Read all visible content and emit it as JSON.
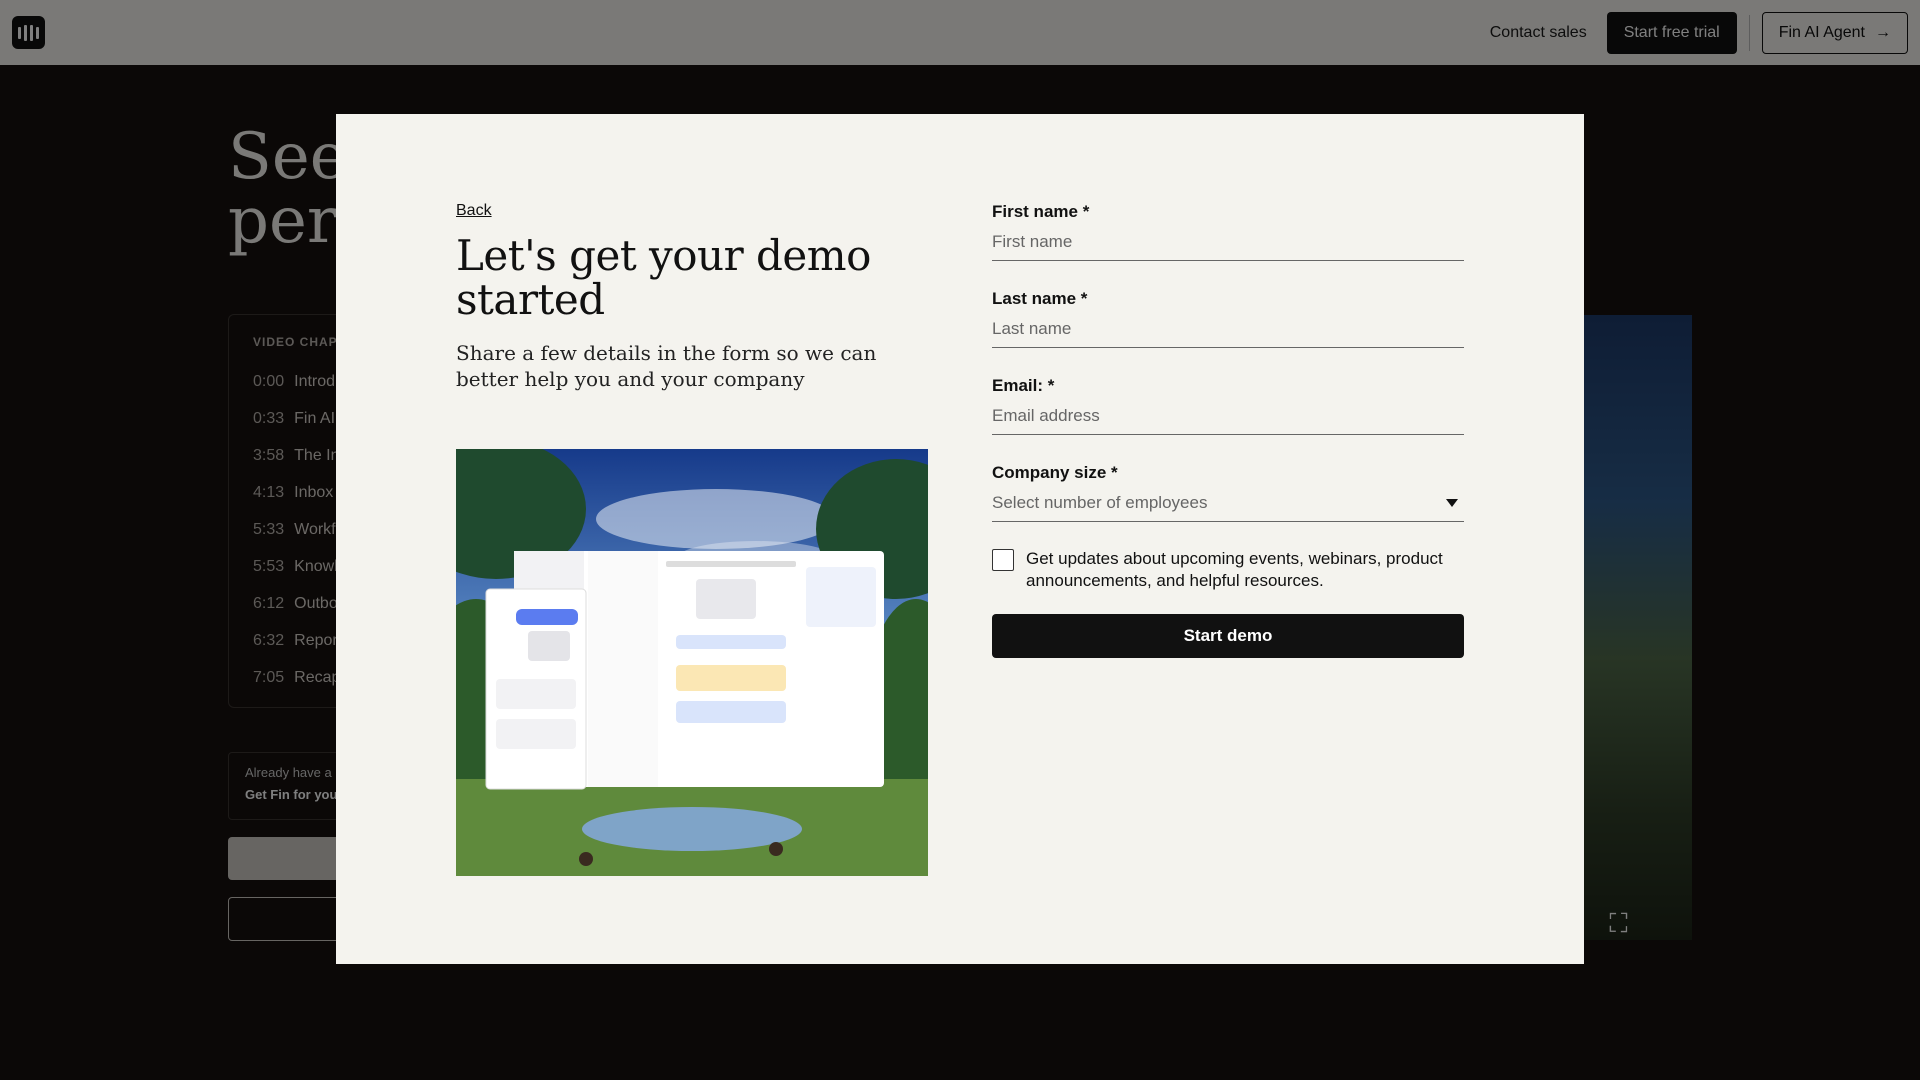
{
  "nav": {
    "contact_sales": "Contact sales",
    "start_trial": "Start free trial",
    "fin_agent": "Fin AI Agent",
    "fin_agent_arrow": "→"
  },
  "background": {
    "title_line1": "See",
    "title_line2": "perf",
    "chapters_heading": "VIDEO CHAPT",
    "chapters": [
      {
        "time": "0:00",
        "label": "Introd"
      },
      {
        "time": "0:33",
        "label": "Fin AI"
      },
      {
        "time": "3:58",
        "label": "The In"
      },
      {
        "time": "4:13",
        "label": "Inbox"
      },
      {
        "time": "5:33",
        "label": "Workf"
      },
      {
        "time": "5:53",
        "label": "Knowl"
      },
      {
        "time": "6:12",
        "label": "Outbo"
      },
      {
        "time": "6:32",
        "label": "Repor"
      },
      {
        "time": "7:05",
        "label": "Recap"
      }
    ],
    "fin_box_text": "Already have a",
    "fin_box_bold": "Get Fin for your"
  },
  "modal": {
    "back": "Back",
    "headline": "Let's get your demo started",
    "subline": "Share a few details in the form so we can better help you and your company",
    "form": {
      "first_name_label": "First name *",
      "first_name_placeholder": "First name",
      "last_name_label": "Last name *",
      "last_name_placeholder": "Last name",
      "email_label": "Email: *",
      "email_placeholder": "Email address",
      "company_size_label": "Company size *",
      "company_size_placeholder": "Select number of employees",
      "updates_text": "Get updates about upcoming events, webinars, product announcements, and helpful resources.",
      "submit": "Start demo"
    }
  }
}
